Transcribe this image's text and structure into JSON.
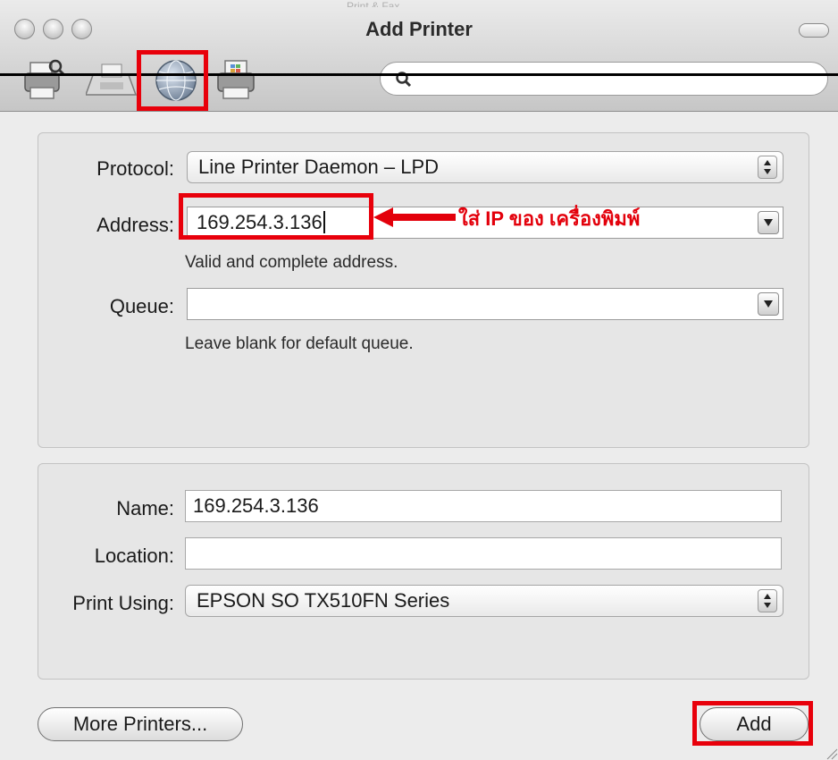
{
  "window": {
    "title": "Add Printer",
    "ghost_title": "Print & Fax"
  },
  "toolbar": {
    "items": [
      {
        "name": "default-browser",
        "icon": "printer-magnifier-icon"
      },
      {
        "name": "fax",
        "icon": "fax-icon"
      },
      {
        "name": "ip",
        "icon": "globe-icon",
        "selected": true
      },
      {
        "name": "windows",
        "icon": "windows-printer-icon"
      }
    ],
    "search": {
      "placeholder": "",
      "value": ""
    }
  },
  "connection": {
    "protocol_label": "Protocol:",
    "protocol_value": "Line Printer Daemon – LPD",
    "address_label": "Address:",
    "address_value": "169.254.3.136",
    "address_hint": "Valid and complete address.",
    "queue_label": "Queue:",
    "queue_value": "",
    "queue_hint": "Leave blank for default queue."
  },
  "details": {
    "name_label": "Name:",
    "name_value": "169.254.3.136",
    "location_label": "Location:",
    "location_value": "",
    "print_using_label": "Print Using:",
    "print_using_value": "EPSON SO TX510FN Series"
  },
  "buttons": {
    "more_printers": "More Printers...",
    "add": "Add"
  },
  "annotation": {
    "text": "ใส่ IP ของ เครื่องพิมพ์",
    "color": "#e3000b"
  },
  "colors": {
    "highlight": "#e8000b",
    "window_bg": "#ececec"
  }
}
